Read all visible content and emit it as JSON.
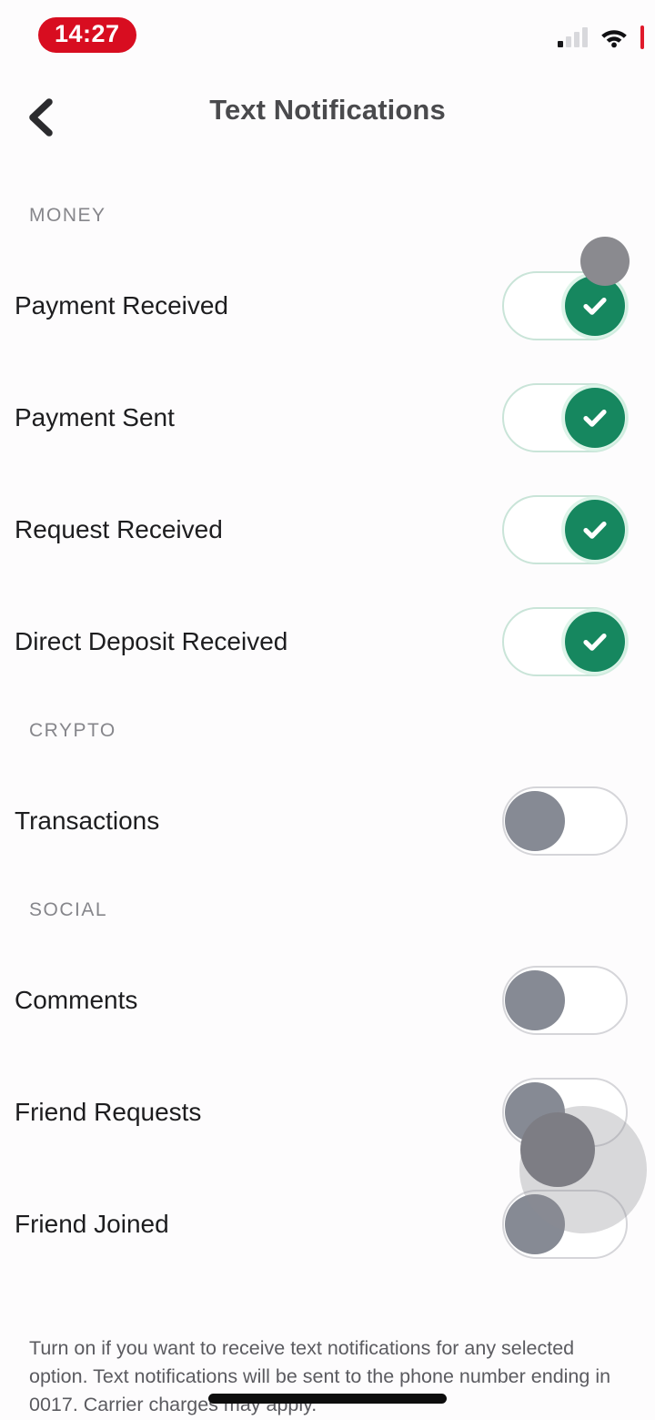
{
  "status_bar": {
    "time": "14:27",
    "time_badge_color": "#d80d20",
    "signal_icon": "cellular-signal-icon",
    "wifi_icon": "wifi-icon",
    "battery_icon": "battery-icon",
    "battery_color": "#e01a2b"
  },
  "header": {
    "back_icon": "chevron-left-icon",
    "title": "Text Notifications"
  },
  "colors": {
    "toggle_on_green": "#16875f",
    "toggle_off_gray": "#868a94",
    "background": "#fdfcfd",
    "title_gray": "#4a4a4d",
    "section_gray": "#86868b"
  },
  "sections": [
    {
      "label": "MONEY",
      "rows": [
        {
          "label": "Payment Received",
          "state": "on",
          "icon": "check-icon"
        },
        {
          "label": "Payment Sent",
          "state": "on",
          "icon": "check-icon"
        },
        {
          "label": "Request Received",
          "state": "on",
          "icon": "check-icon"
        },
        {
          "label": "Direct Deposit Received",
          "state": "on",
          "icon": "check-icon"
        }
      ]
    },
    {
      "label": "CRYPTO",
      "rows": [
        {
          "label": "Transactions",
          "state": "off",
          "icon": ""
        }
      ]
    },
    {
      "label": "SOCIAL",
      "rows": [
        {
          "label": "Comments",
          "state": "off",
          "icon": ""
        },
        {
          "label": "Friend Requests",
          "state": "off",
          "icon": ""
        },
        {
          "label": "Friend Joined",
          "state": "off",
          "icon": ""
        }
      ]
    }
  ],
  "footer": {
    "note": "Turn on if you want to receive text notifications for any selected option. Text notifications will be sent to the phone number ending in 0017. Carrier charges may apply."
  }
}
